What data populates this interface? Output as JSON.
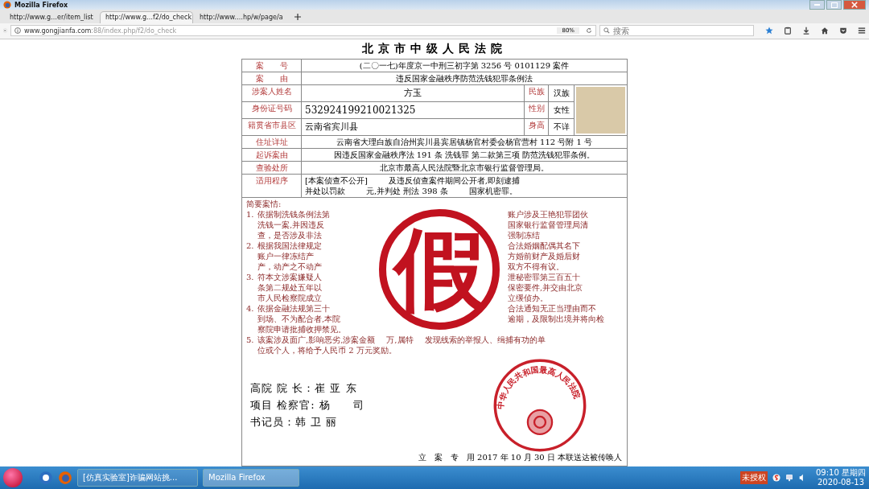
{
  "window": {
    "title": "Mozilla Firefox"
  },
  "tabs": [
    {
      "label": "http://www.g…er/item_list",
      "selected": false
    },
    {
      "label": "http://www.g…f2/do_check",
      "selected": true
    },
    {
      "label": "http://www.…hp/w/page/a",
      "selected": false
    }
  ],
  "address_bar": {
    "url_host": "www.gongjianfa.com",
    "url_rest": ":88/index.php/f2/do_check",
    "zoom": "80%"
  },
  "search": {
    "placeholder": "搜索"
  },
  "document": {
    "title": "北京市中级人民法院",
    "rows": [
      {
        "kind": "wide",
        "label": "案　　号",
        "value": "(二〇一七)年度京一中刑三初字第 3256 号 0101129 案件"
      },
      {
        "kind": "wide",
        "label": "案　　由",
        "value": "违反国家金融秩序防范洗钱犯罪条例法"
      },
      {
        "kind": "person",
        "label": "涉案人姓名",
        "value": "方玉",
        "side_label": "民族",
        "side_value": "汉族"
      },
      {
        "kind": "person",
        "label": "身份证号码",
        "value": "532924199210021325",
        "side_label": "性别",
        "side_value": "女性"
      },
      {
        "kind": "person",
        "label": "籍贯省市县区",
        "value": "云南省宾川县",
        "side_label": "身高",
        "side_value": "不详"
      },
      {
        "kind": "wide",
        "label": "住址详址",
        "value": "云南省大理白族自治州宾川县宾居镇杨官村委会杨官营村 112 号附 1 号"
      },
      {
        "kind": "wide",
        "label": "起诉案由",
        "value": "因违反国家金融秩序法 191 条 洗钱罪 第二款第三项 防范洗钱犯罪条例。"
      },
      {
        "kind": "wide",
        "label": "查验处所",
        "value": "北京市最高人民法院暨北京市银行监督管理局。"
      },
      {
        "kind": "multi",
        "label": "适用程序",
        "lines": [
          [
            "[本案侦查不公开]",
            "及违反侦查案件期间公开者,即刻逮捕"
          ],
          [
            "并处以罚款",
            "元,并判处 刑法 398 条",
            "国家机密罪。"
          ]
        ]
      }
    ],
    "case_heading": "简要案情:",
    "case_items": [
      {
        "number": "1.",
        "lines": [
          [
            "依据制洗钱条例法第",
            "账户涉及王艳犯罪团伙"
          ],
          [
            "洗钱一案,并因违反",
            "国家银行监督管理局清"
          ],
          [
            "查，是否涉及非法",
            "强制冻结"
          ]
        ]
      },
      {
        "number": "2.",
        "lines": [
          [
            "根据我国法律规定",
            "合法婚姻配偶其名下"
          ],
          [
            "账户一律冻结产",
            "方婚前财产及婚后财"
          ],
          [
            "产，动产之不动产",
            "双方不得有议。"
          ]
        ]
      },
      {
        "number": "3.",
        "lines": [
          [
            "符本文涉案嫌疑人",
            "泄秘密罪第三百五十"
          ],
          [
            "条第二规处五年以",
            "保密要件,并交由北京"
          ],
          [
            "市人民检察院成立",
            "立缓侦办。"
          ]
        ]
      },
      {
        "number": "4.",
        "lines": [
          [
            "依据金融法规第三十",
            "合法通知无正当理由而不"
          ],
          [
            "到场、不为配合者,本院",
            "逾期，及限制出境并将向检"
          ],
          [
            "察院申请批捕收押禁见。"
          ]
        ]
      },
      {
        "number": "5.",
        "lines": [
          [
            "该案涉及面广,影响恶劣,涉案金额",
            "万,属特",
            "发现线索的举报人、缉捕有功的单"
          ],
          [
            "位或个人，将给予人民币 2 万元奖励。"
          ]
        ]
      }
    ],
    "signatures": [
      "高院 院 长：崔 亚 东",
      "项目 检察官: 杨　　司",
      "书记员：韩 卫 丽"
    ],
    "seal_text": "中华人民共和国最高人民法院",
    "stamp": "假",
    "footer": "立　案　专　用 2017 年 10 月 30 日 本联送达被传唤人"
  },
  "taskbar": {
    "tasks": [
      {
        "label": "[仿真实验室]诈骗网站挑...",
        "selected": false
      },
      {
        "label": "Mozilla Firefox",
        "selected": true
      }
    ],
    "tray_badge": "未授权",
    "time": "09:10 星期四",
    "date": "2020-08-13"
  }
}
